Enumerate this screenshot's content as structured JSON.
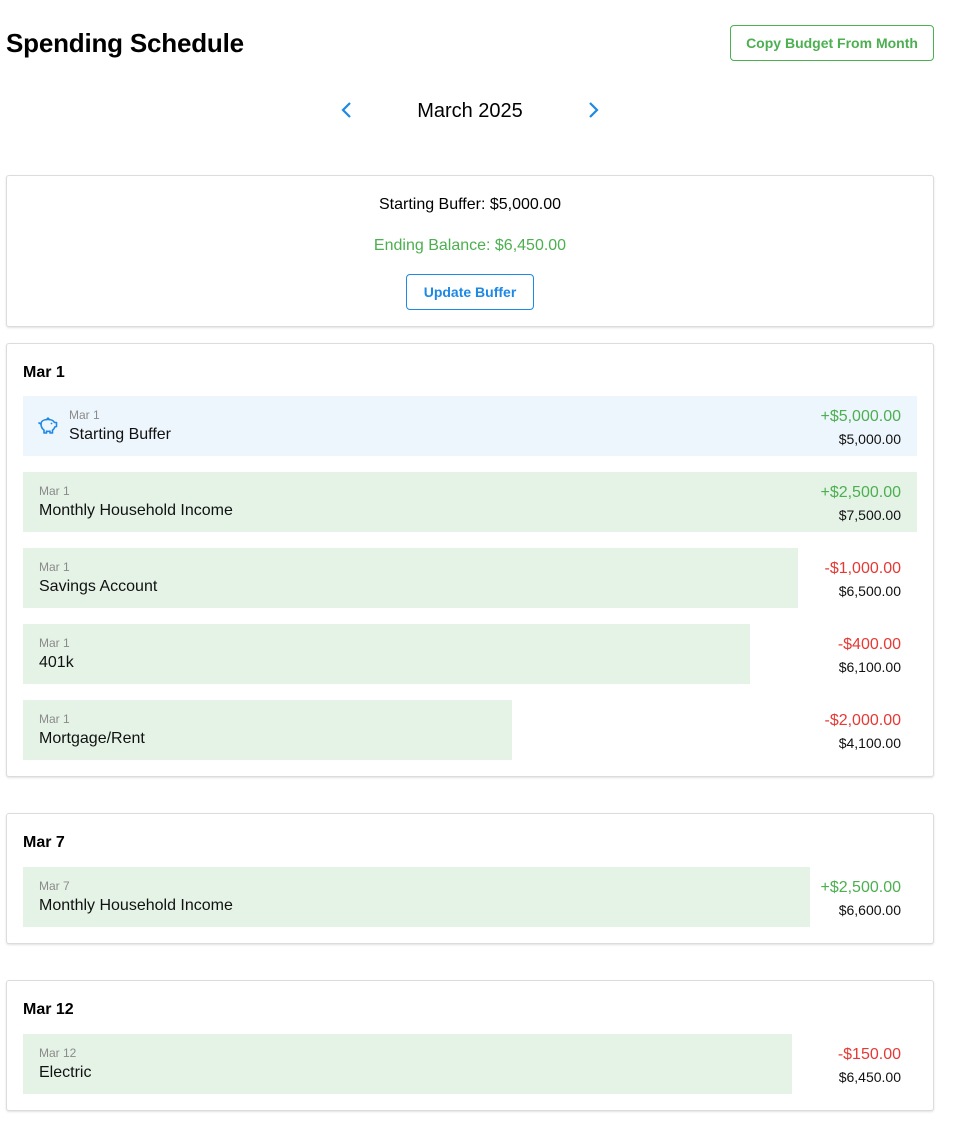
{
  "header": {
    "title": "Spending Schedule",
    "copy_button": "Copy Budget From Month"
  },
  "month_nav": {
    "label": "March 2025",
    "prev_icon": "chevron-left-icon",
    "next_icon": "chevron-right-icon"
  },
  "buffer": {
    "starting": "Starting Buffer: $5,000.00",
    "ending": "Ending Balance: $6,450.00",
    "update_button": "Update Buffer"
  },
  "colors": {
    "positive": "#4caf50",
    "negative": "#e53935",
    "accent_blue": "#1e88e5",
    "income_bar": "#e5f3e7",
    "buffer_bar": "#eef6fd"
  },
  "days": [
    {
      "title": "Mar 1",
      "entries": [
        {
          "date": "Mar 1",
          "name": "Starting Buffer",
          "amount": "+$5,000.00",
          "balance": "$5,000.00",
          "sign": "pos",
          "icon": "piggy-bank-icon",
          "fill": 1.0
        },
        {
          "date": "Mar 1",
          "name": "Monthly Household Income",
          "amount": "+$2,500.00",
          "balance": "$7,500.00",
          "sign": "pos",
          "fill": 1.0
        },
        {
          "date": "Mar 1",
          "name": "Savings Account",
          "amount": "-$1,000.00",
          "balance": "$6,500.00",
          "sign": "neg",
          "fill": 0.867
        },
        {
          "date": "Mar 1",
          "name": "401k",
          "amount": "-$400.00",
          "balance": "$6,100.00",
          "sign": "neg",
          "fill": 0.813
        },
        {
          "date": "Mar 1",
          "name": "Mortgage/Rent",
          "amount": "-$2,000.00",
          "balance": "$4,100.00",
          "sign": "neg",
          "fill": 0.547
        }
      ]
    },
    {
      "title": "Mar 7",
      "entries": [
        {
          "date": "Mar 7",
          "name": "Monthly Household Income",
          "amount": "+$2,500.00",
          "balance": "$6,600.00",
          "sign": "pos",
          "fill": 0.88
        }
      ]
    },
    {
      "title": "Mar 12",
      "entries": [
        {
          "date": "Mar 12",
          "name": "Electric",
          "amount": "-$150.00",
          "balance": "$6,450.00",
          "sign": "neg",
          "fill": 0.86
        }
      ]
    }
  ]
}
